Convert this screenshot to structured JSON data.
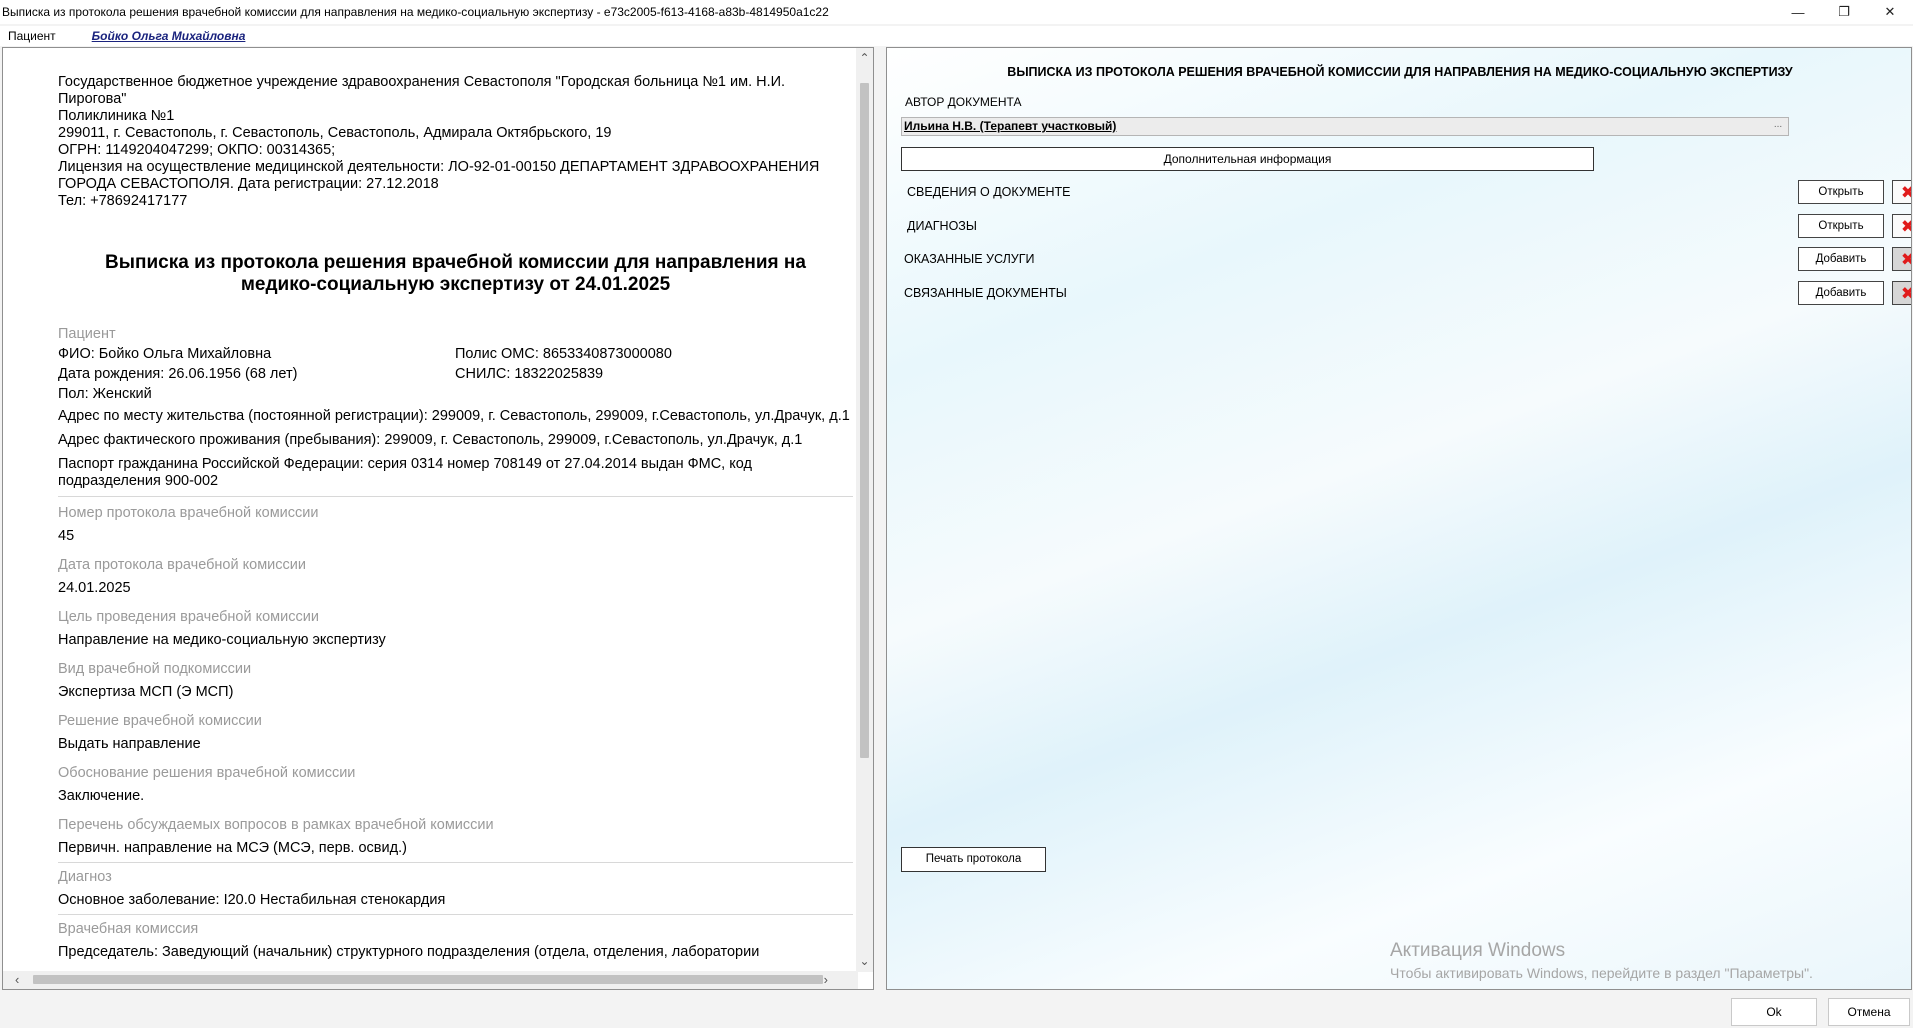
{
  "window": {
    "title": "Выписка из протокола решения врачебной комиссии для направления на медико-социальную экспертизу - e73c2005-f613-4168-a83b-4814950a1c22"
  },
  "menubar": {
    "patient_menu": "Пациент",
    "patient_link": "Бойко Ольга Михайловна"
  },
  "document": {
    "org_lines": [
      "Государственное бюджетное учреждение здравоохранения Севастополя \"Городская больница №1 им. Н.И. Пирогова\"",
      "Поликлиника №1",
      "299011, г. Севастополь, г. Севастополь, Севастополь, Адмирала Октябрьского, 19",
      "ОГРН: 1149204047299; ОКПО: 00314365;",
      "Лицензия на осуществление медицинской деятельности: ЛО-92-01-00150 ДЕПАРТАМЕНТ ЗДРАВООХРАНЕНИЯ ГОРОДА СЕВАСТОПОЛЯ. Дата регистрации: 27.12.2018",
      "Тел: +78692417177"
    ],
    "title": "Выписка из протокола решения врачебной комиссии для направления на медико-социальную экспертизу от 24.01.2025",
    "patient_label": "Пациент",
    "fio": "ФИО: Бойко Ольга Михайловна",
    "polis": "Полис ОМС: 8653340873000080",
    "birth": "Дата рождения: 26.06.1956 (68 лет)",
    "snils": "СНИЛС: 18322025839",
    "gender": "Пол: Женский",
    "addr_reg": "Адрес по месту жительства (постоянной регистрации): 299009, г. Севастополь, 299009, г.Севастополь, ул.Драчук, д.1",
    "addr_fact": "Адрес фактического проживания (пребывания): 299009, г. Севастополь, 299009, г.Севастополь, ул.Драчук, д.1",
    "passport": "Паспорт гражданина Российской Федерации: серия 0314 номер 708149 от 27.04.2014 выдан ФМС, код подразделения 900-002",
    "fields": [
      {
        "label": "Номер протокола врачебной комиссии",
        "value": "45"
      },
      {
        "label": "Дата протокола врачебной комиссии",
        "value": "24.01.2025"
      },
      {
        "label": "Цель проведения врачебной комиссии",
        "value": "Направление на медико-социальную экспертизу"
      },
      {
        "label": "Вид врачебной подкомиссии",
        "value": "Экспертиза МСП (Э МСП)"
      },
      {
        "label": "Решение врачебной комиссии",
        "value": "Выдать направление"
      },
      {
        "label": "Обоснование решения врачебной комиссии",
        "value": "Заключение."
      },
      {
        "label": "Перечень обсуждаемых вопросов в рамках врачебной комиссии",
        "value": "Первичн. направление на МСЭ (МСЭ, перв. освид.)"
      },
      {
        "label": "Диагноз",
        "value": "Основное заболевание: I20.0 Нестабильная стенокардия"
      },
      {
        "label": "Врачебная комиссия",
        "value": "Председатель: Заведующий (начальник) структурного подразделения (отдела, отделения, лаборатории"
      }
    ]
  },
  "right": {
    "heading": "ВЫПИСКА ИЗ ПРОТОКОЛА РЕШЕНИЯ ВРАЧЕБНОЙ КОМИССИИ ДЛЯ НАПРАВЛЕНИЯ НА МЕДИКО-СОЦИАЛЬНУЮ ЭКСПЕРТИЗУ",
    "author_label": "АВТОР ДОКУМЕНТА",
    "author_value": "Ильина Н.В. (Терапевт участковый)",
    "author_ellipsis": "...",
    "extra_info": "Дополнительная информация",
    "sections": [
      {
        "name": "СВЕДЕНИЯ О ДОКУМЕНТЕ",
        "action": "Открыть",
        "delete_enabled": true
      },
      {
        "name": "ДИАГНОЗЫ",
        "action": "Открыть",
        "delete_enabled": true
      },
      {
        "name": "ОКАЗАННЫЕ УСЛУГИ",
        "action": "Добавить",
        "delete_enabled": false
      },
      {
        "name": "СВЯЗАННЫЕ ДОКУМЕНТЫ",
        "action": "Добавить",
        "delete_enabled": false
      }
    ],
    "print_button": "Печать протокола",
    "watermark_title": "Активация Windows",
    "watermark_text": "Чтобы активировать Windows, перейдите в раздел \"Параметры\"."
  },
  "footer": {
    "ok": "Ok",
    "cancel": "Отмена"
  },
  "colors": {
    "link": "#1a237e",
    "delete_x": "#e01b1b",
    "muted_label": "#9a9a9a"
  }
}
